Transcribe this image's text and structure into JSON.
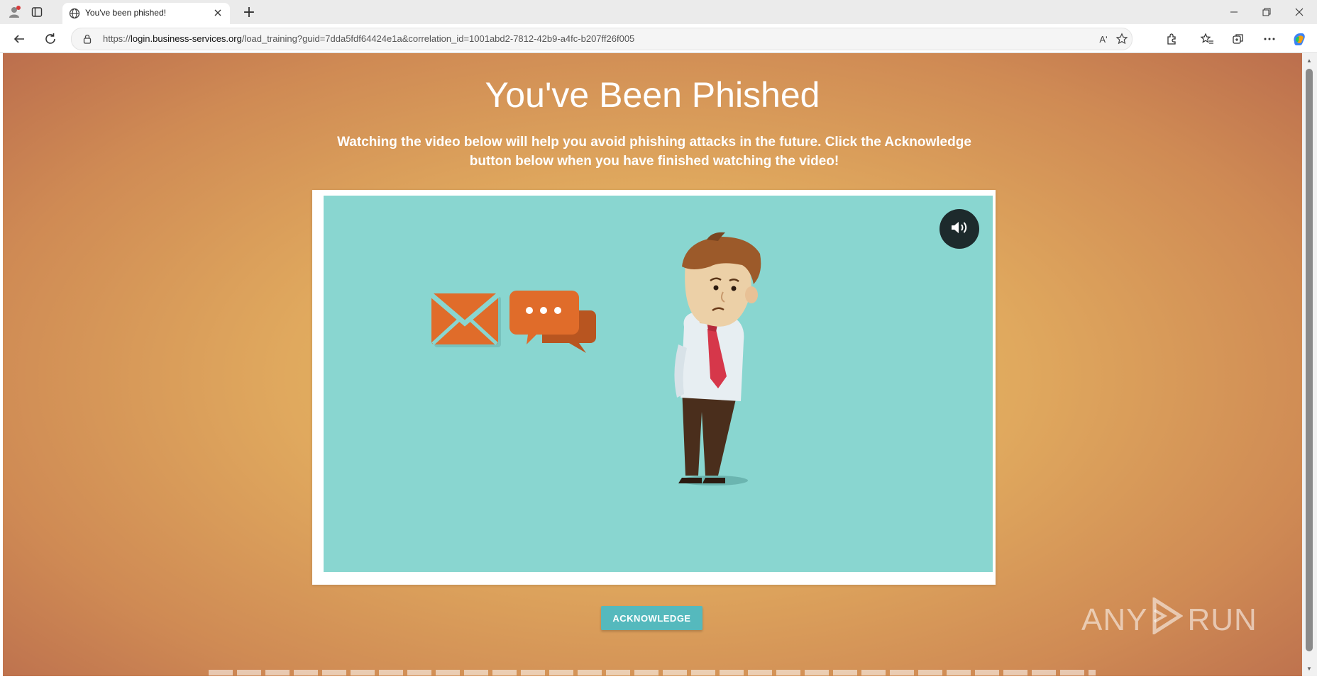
{
  "browser": {
    "tab": {
      "title": "You've been phished!"
    },
    "new_tab_label": "+",
    "address": {
      "url_scheme": "https://",
      "url_host": "login.business-services.org",
      "url_path": "/load_training?guid=7dda5fdf64424e1a&correlation_id=1001abd2-7812-42b9-a4fc-b207ff26f005"
    },
    "read_aloud_label": "Aʹ"
  },
  "page": {
    "title": "You've Been Phished",
    "subtitle": "Watching the video below will help you avoid phishing attacks in the future. Click the Acknowledge button below when you have finished watching the video!",
    "acknowledge_label": "ACKNOWLEDGE",
    "video": {
      "muted": false
    }
  },
  "watermark": {
    "left": "ANY",
    "right": "RUN"
  },
  "colors": {
    "accent_button": "#55b9bd",
    "video_bg": "#89d6d0",
    "icon_orange": "#e06c2a",
    "tie_red": "#d6374a"
  },
  "icons": [
    "profile-icon",
    "tab-actions-icon",
    "globe-icon",
    "close-icon",
    "back-icon",
    "refresh-icon",
    "site-info-icon",
    "read-aloud-icon",
    "favorite-icon",
    "extensions-icon",
    "favorites-icon",
    "collections-icon",
    "more-icon",
    "copilot-icon",
    "volume-icon",
    "envelope-icon",
    "chat-bubbles-icon"
  ]
}
